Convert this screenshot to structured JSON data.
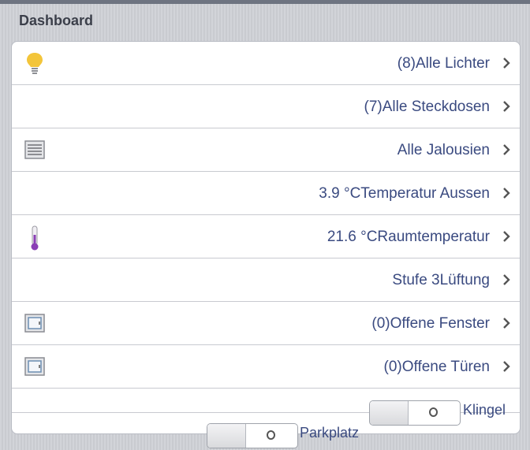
{
  "header": {
    "title": "Dashboard"
  },
  "rows": [
    {
      "label": "(8)Alle Lichter",
      "icon": "lightbulb-icon"
    },
    {
      "label": "(7)Alle Steckdosen",
      "icon": ""
    },
    {
      "label": "Alle Jalousien",
      "icon": "blinds-icon"
    },
    {
      "label": "3.9 °CTemperatur Aussen",
      "icon": ""
    },
    {
      "label": "21.6 °CRaumtemperatur",
      "icon": "thermometer-icon"
    },
    {
      "label": "Stufe 3Lüftung",
      "icon": ""
    },
    {
      "label": "(0)Offene Fenster",
      "icon": "window-icon"
    },
    {
      "label": "(0)Offene Türen",
      "icon": "window-icon"
    }
  ],
  "switches": [
    {
      "label": "Klingel",
      "state": "off",
      "knob_glyph": "O"
    },
    {
      "label": "Parkplatz",
      "state": "off",
      "knob_glyph": "O"
    }
  ],
  "colors": {
    "label": "#3a4a80",
    "bulb": "#f3c53a",
    "thermometer": "#8a3fb5"
  }
}
